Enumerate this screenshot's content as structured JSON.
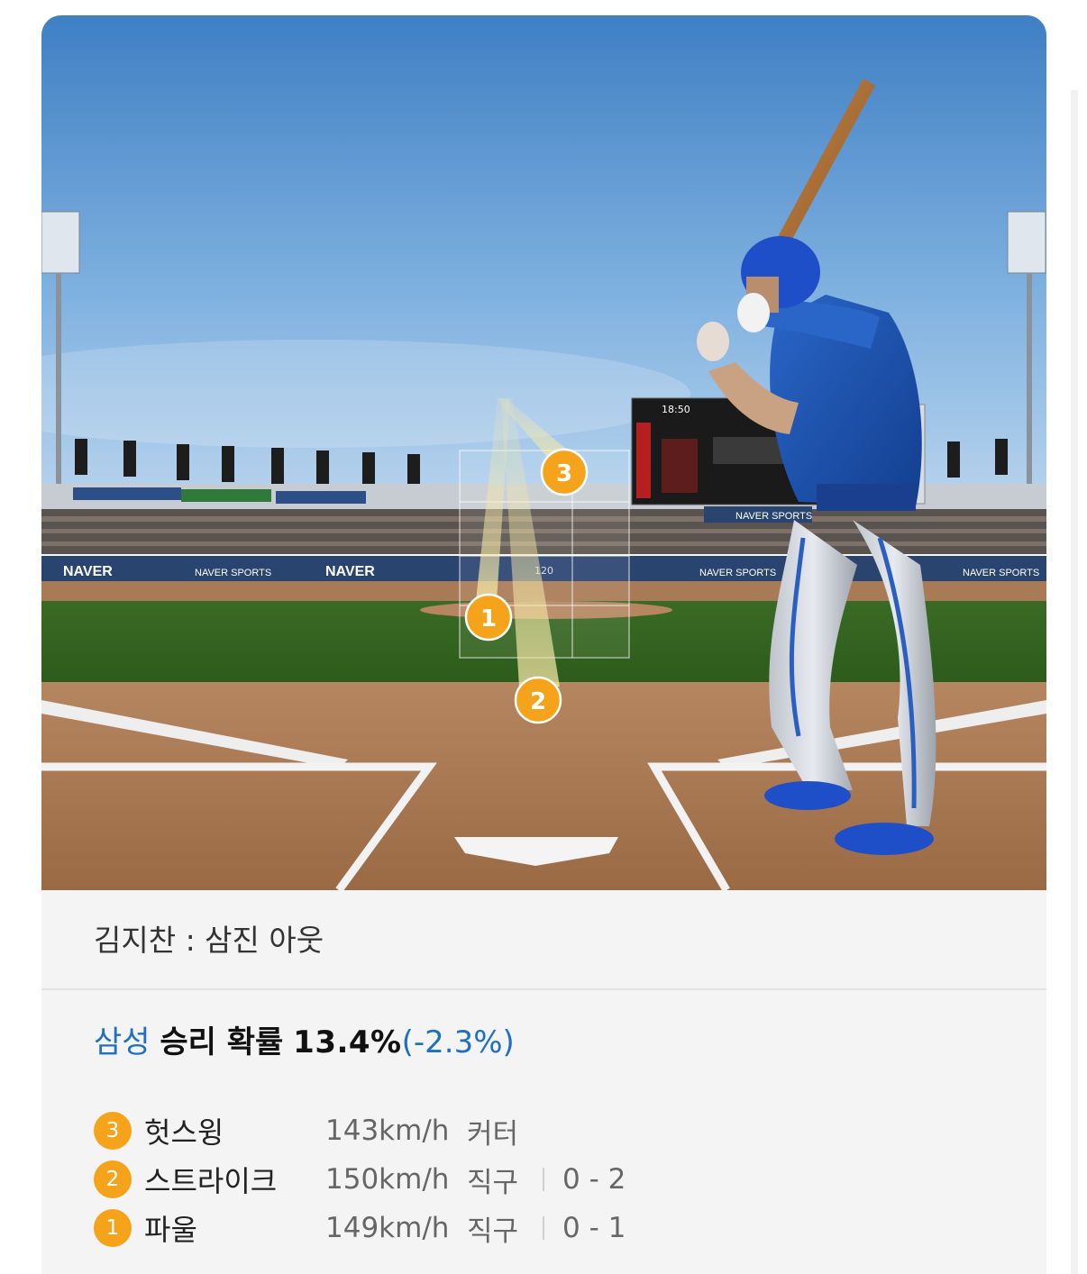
{
  "scene": {
    "banners": [
      "NAVER",
      "NAVER SPORTS",
      "NAVER",
      "NAVER SPORTS",
      "NAVER SPORTS",
      "NAVER SPORTS"
    ],
    "scoreboard_time": "18:50",
    "zone_speed": "120",
    "pitch_markers": [
      "3",
      "1",
      "2"
    ]
  },
  "result": {
    "text": "김지찬 : 삼진 아웃"
  },
  "win_probability": {
    "team": "삼성",
    "label": "승리 확률",
    "value": "13.4%",
    "delta": "(-2.3%)",
    "team_color": "#1f6fc3",
    "accent_color": "#f5a31a"
  },
  "pitches": [
    {
      "num": "3",
      "result": "헛스윙",
      "speed": "143km/h",
      "type": "커터",
      "count": ""
    },
    {
      "num": "2",
      "result": "스트라이크",
      "speed": "150km/h",
      "type": "직구",
      "count": "0 - 2"
    },
    {
      "num": "1",
      "result": "파울",
      "speed": "149km/h",
      "type": "직구",
      "count": "0 - 1"
    }
  ]
}
